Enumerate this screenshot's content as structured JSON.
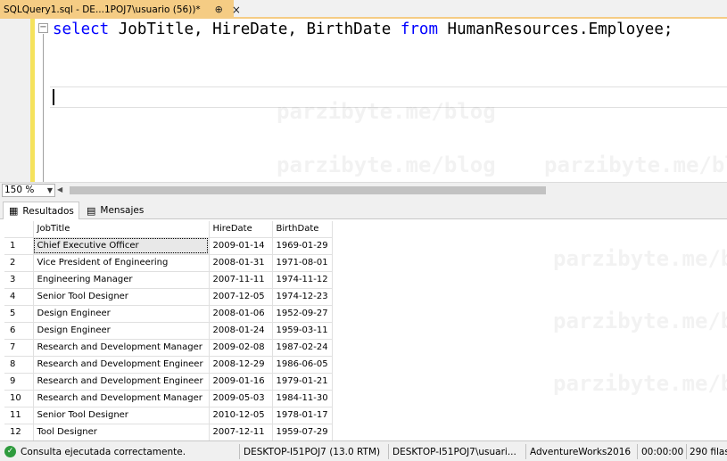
{
  "tab": {
    "title": "SQLQuery1.sql - DE...1POJ7\\usuario (56))*",
    "pin": "⊕",
    "close": "×"
  },
  "editor": {
    "code": {
      "kw1": "select",
      "cols": " JobTitle, HireDate, BirthDate ",
      "kw2": "from",
      "table": " HumanResources.Employee;"
    },
    "watermark": "parzibyte.me/blog"
  },
  "zoom": {
    "value": "150 %"
  },
  "results_tabs": [
    {
      "label": "Resultados",
      "icon": "grid-icon"
    },
    {
      "label": "Mensajes",
      "icon": "messages-icon"
    }
  ],
  "grid": {
    "columns": [
      "JobTitle",
      "HireDate",
      "BirthDate"
    ],
    "rows": [
      {
        "n": "1",
        "job": "Chief Executive Officer",
        "hire": "2009-01-14",
        "birth": "1969-01-29"
      },
      {
        "n": "2",
        "job": "Vice President of Engineering",
        "hire": "2008-01-31",
        "birth": "1971-08-01"
      },
      {
        "n": "3",
        "job": "Engineering Manager",
        "hire": "2007-11-11",
        "birth": "1974-11-12"
      },
      {
        "n": "4",
        "job": "Senior Tool Designer",
        "hire": "2007-12-05",
        "birth": "1974-12-23"
      },
      {
        "n": "5",
        "job": "Design Engineer",
        "hire": "2008-01-06",
        "birth": "1952-09-27"
      },
      {
        "n": "6",
        "job": "Design Engineer",
        "hire": "2008-01-24",
        "birth": "1959-03-11"
      },
      {
        "n": "7",
        "job": "Research and Development Manager",
        "hire": "2009-02-08",
        "birth": "1987-02-24"
      },
      {
        "n": "8",
        "job": "Research and Development Engineer",
        "hire": "2008-12-29",
        "birth": "1986-06-05"
      },
      {
        "n": "9",
        "job": "Research and Development Engineer",
        "hire": "2009-01-16",
        "birth": "1979-01-21"
      },
      {
        "n": "10",
        "job": "Research and Development Manager",
        "hire": "2009-05-03",
        "birth": "1984-11-30"
      },
      {
        "n": "11",
        "job": "Senior Tool Designer",
        "hire": "2010-12-05",
        "birth": "1978-01-17"
      },
      {
        "n": "12",
        "job": "Tool Designer",
        "hire": "2007-12-11",
        "birth": "1959-07-29"
      }
    ]
  },
  "status": {
    "message": "Consulta ejecutada correctamente.",
    "server": "DESKTOP-I51POJ7 (13.0 RTM)",
    "user": "DESKTOP-I51POJ7\\usuari...",
    "database": "AdventureWorks2016",
    "time": "00:00:00",
    "rows": "290 filas"
  },
  "colors": {
    "tab_active": "#f5cc84",
    "keyword": "#0000ff",
    "change_bar": "#f5e25c",
    "ok_green": "#2e9b3d"
  }
}
